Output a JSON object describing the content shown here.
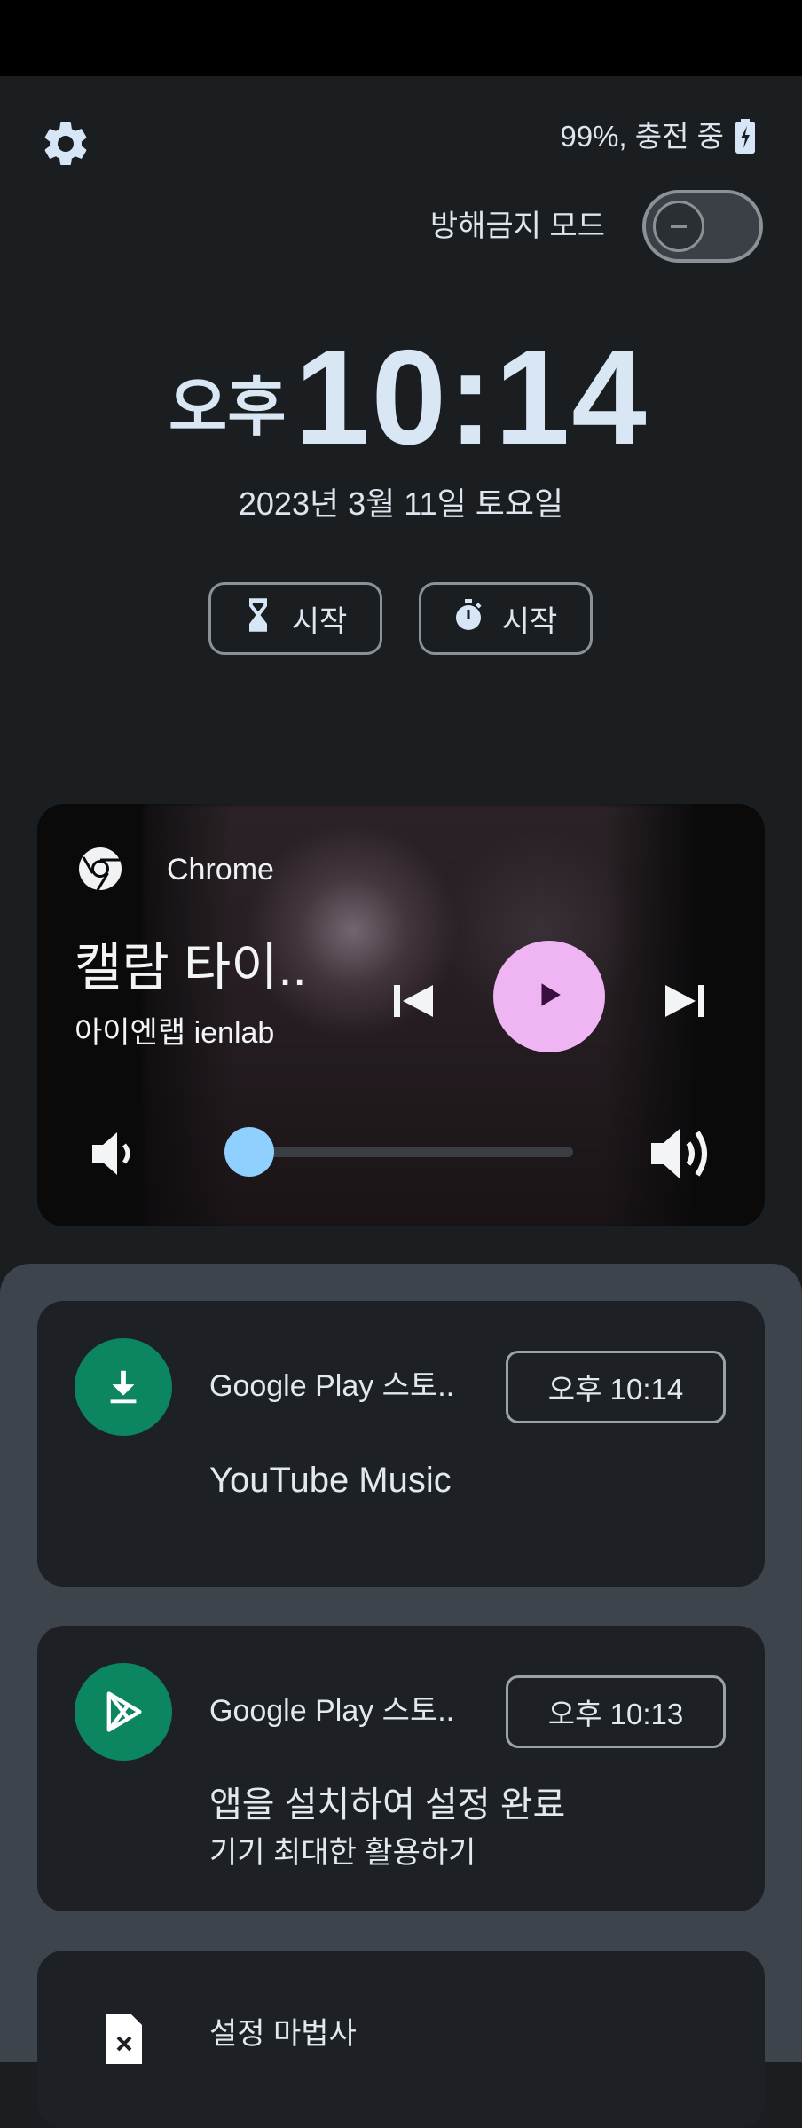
{
  "header": {
    "battery_text": "99%, 충전 중",
    "dnd_label": "방해금지 모드",
    "dnd_enabled": false
  },
  "clock": {
    "ampm": "오후",
    "time": "10:14",
    "date": "2023년 3월 11일 토요일"
  },
  "quick_actions": {
    "timer_label": "시작",
    "stopwatch_label": "시작"
  },
  "media": {
    "app_name": "Chrome",
    "title": "캘람 타이..",
    "artist": "아이엔랩 ienlab",
    "volume_fraction": 0.05,
    "accent_color": "#efb4f2",
    "slider_color": "#8fd0ff"
  },
  "notifications": [
    {
      "app": "Google Play 스토..",
      "time": "오후 10:14",
      "title": "YouTube Music",
      "subtitle": "",
      "icon": "download-icon"
    },
    {
      "app": "Google Play 스토..",
      "time": "오후 10:13",
      "title": "앱을 설치하여 설정 완료",
      "subtitle": "기기 최대한 활용하기",
      "icon": "play-store-icon"
    },
    {
      "title": "설정 마법사",
      "icon": "sim-card-error-icon"
    }
  ]
}
